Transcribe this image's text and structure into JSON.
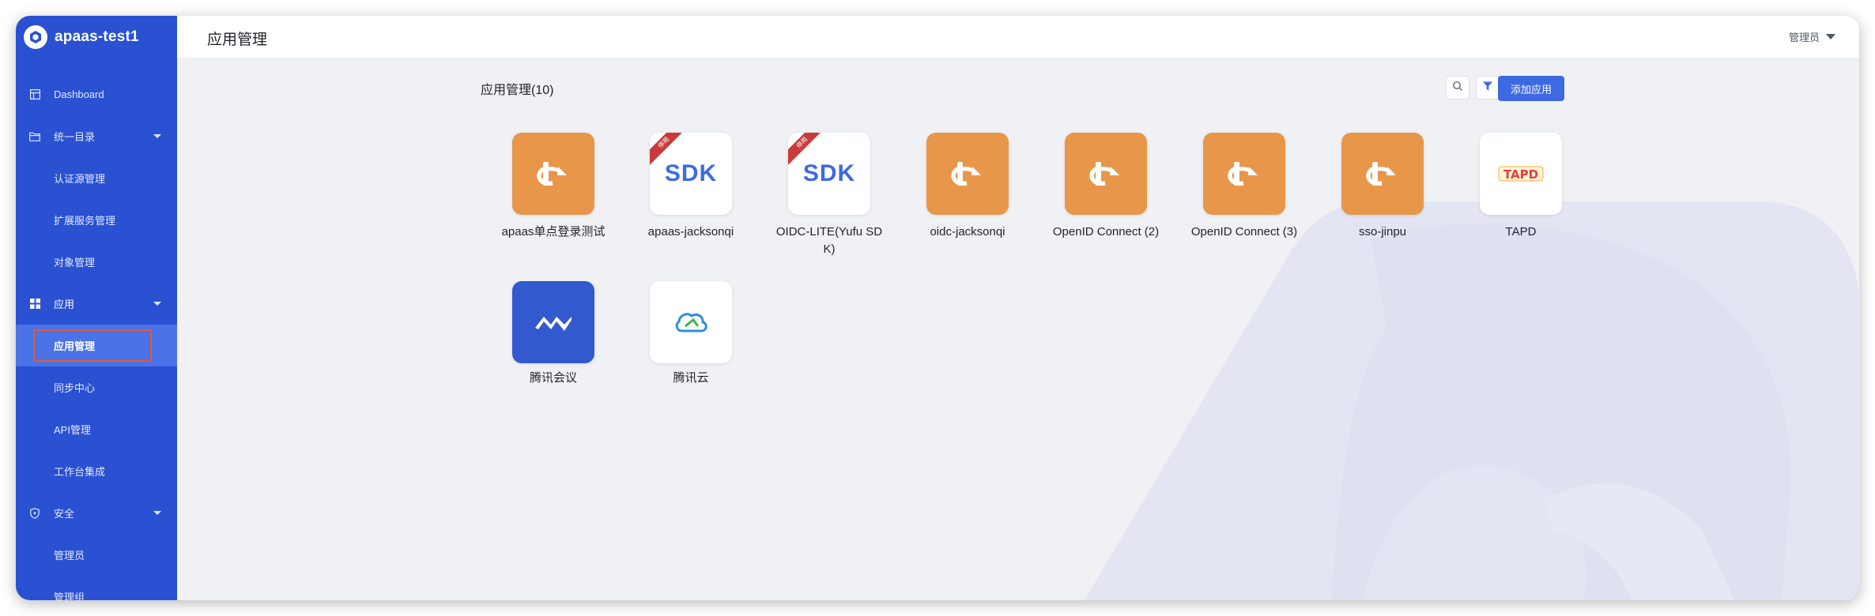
{
  "brand": {
    "name": "apaas-test1"
  },
  "sidebar": {
    "items": [
      {
        "label": "Dashboard"
      },
      {
        "label": "统一目录"
      },
      {
        "label": "认证源管理"
      },
      {
        "label": "扩展服务管理"
      },
      {
        "label": "对象管理"
      },
      {
        "label": "应用"
      },
      {
        "label": "应用管理"
      },
      {
        "label": "同步中心"
      },
      {
        "label": "API管理"
      },
      {
        "label": "工作台集成"
      },
      {
        "label": "安全"
      },
      {
        "label": "管理员"
      },
      {
        "label": "管理组"
      }
    ]
  },
  "header": {
    "title": "应用管理",
    "user": "管理员"
  },
  "main": {
    "section_title": "应用管理(10)",
    "add_button": "添加应用",
    "apps": [
      {
        "name": "apaas单点登录测试",
        "icon": "openid-icon"
      },
      {
        "name": "apaas-jacksonqi",
        "icon": "sdk-icon",
        "icon_text": "SDK",
        "ribbon": "停用"
      },
      {
        "name": "OIDC-LITE(Yufu SDK)",
        "icon": "sdk-icon",
        "icon_text": "SDK",
        "ribbon": "停用"
      },
      {
        "name": "oidc-jacksonqi",
        "icon": "openid-icon"
      },
      {
        "name": "OpenID Connect (2)",
        "icon": "openid-icon"
      },
      {
        "name": "OpenID Connect (3)",
        "icon": "openid-icon"
      },
      {
        "name": "sso-jinpu",
        "icon": "openid-icon"
      },
      {
        "name": "TAPD",
        "icon": "tapd-logo",
        "icon_text": "TAPD"
      },
      {
        "name": "腾讯会议",
        "icon": "tencent-meeting-icon"
      },
      {
        "name": "腾讯云",
        "icon": "tencent-cloud-icon"
      }
    ]
  },
  "colors": {
    "sidebar": "#2a51d2",
    "sidebar_active": "#4b72e6",
    "accent": "#3d6ae3",
    "app_orange": "#e8964a",
    "ribbon_red": "#c93a3a",
    "highlight": "#e05a3e"
  }
}
